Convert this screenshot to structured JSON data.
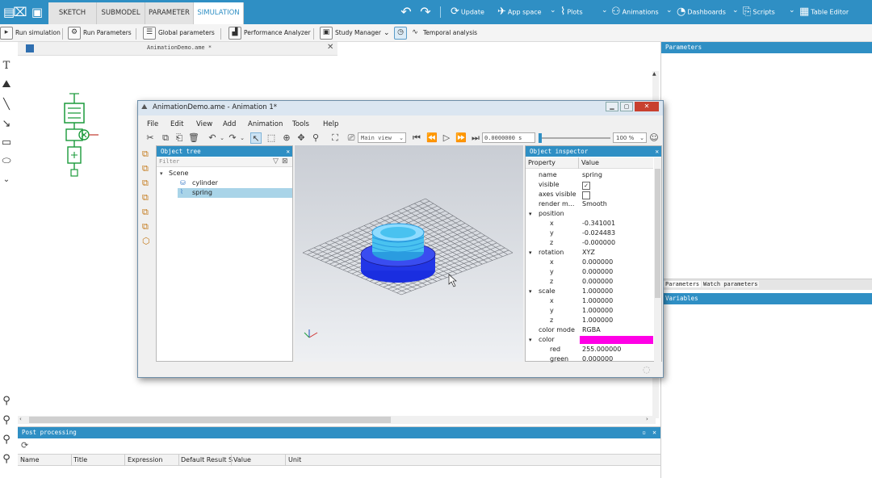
{
  "ribbon": {
    "tabs": [
      "SKETCH",
      "SUBMODEL",
      "PARAMETER",
      "SIMULATION"
    ],
    "active_tab": "SIMULATION",
    "buttons": [
      "Update",
      "App space",
      "Plots",
      "Animations",
      "Dashboards",
      "Scripts",
      "Table Editor"
    ]
  },
  "toolbar2": {
    "run_simulation": "Run simulation",
    "run_parameters": "Run Parameters",
    "global_parameters": "Global parameters",
    "performance_analyzer": "Performance Analyzer",
    "study_manager": "Study Manager",
    "temporal_analysis": "Temporal analysis"
  },
  "sketch": {
    "tab_title": "AnimationDemo.ame *"
  },
  "right_panel": {
    "parameters_title": "Parameters",
    "tabs": [
      "Parameters",
      "Watch parameters"
    ],
    "variables_title": "Variables"
  },
  "post_processing": {
    "title": "Post processing",
    "columns": [
      "Name",
      "Title",
      "Expression",
      "Default Result S",
      "Value",
      "Unit"
    ]
  },
  "anim_window": {
    "title": "AnimationDemo.ame - Animation 1*",
    "menu": [
      "File",
      "Edit",
      "View",
      "Add",
      "Animation",
      "Tools",
      "Help"
    ],
    "view_select": "Main view",
    "time_value": "0.0000000 s",
    "zoom_select": "100 %",
    "object_tree": {
      "title": "Object tree",
      "filter_placeholder": "Filter",
      "root": "Scene",
      "children": [
        "cylinder",
        "spring"
      ],
      "selected": "spring"
    },
    "object_inspector": {
      "title": "Object inspector",
      "col_property": "Property",
      "col_value": "Value",
      "rows": [
        {
          "property": "name",
          "value": "spring",
          "indent": 1
        },
        {
          "property": "visible",
          "value": "checked",
          "indent": 1,
          "type": "checkbox"
        },
        {
          "property": "axes visible",
          "value": "unchecked",
          "indent": 1,
          "type": "checkbox"
        },
        {
          "property": "render m...",
          "value": "Smooth",
          "indent": 1
        },
        {
          "property": "position",
          "value": "",
          "indent": 0,
          "group": true
        },
        {
          "property": "x",
          "value": "-0.341001",
          "indent": 2
        },
        {
          "property": "y",
          "value": "-0.024483",
          "indent": 2
        },
        {
          "property": "z",
          "value": "-0.000000",
          "indent": 2
        },
        {
          "property": "rotation",
          "value": "XYZ",
          "indent": 0,
          "group": true
        },
        {
          "property": "x",
          "value": "0.000000",
          "indent": 2
        },
        {
          "property": "y",
          "value": "0.000000",
          "indent": 2
        },
        {
          "property": "z",
          "value": "0.000000",
          "indent": 2
        },
        {
          "property": "scale",
          "value": "1.000000",
          "indent": 0,
          "group": true
        },
        {
          "property": "x",
          "value": "1.000000",
          "indent": 2
        },
        {
          "property": "y",
          "value": "1.000000",
          "indent": 2
        },
        {
          "property": "z",
          "value": "1.000000",
          "indent": 2
        },
        {
          "property": "color mode",
          "value": "RGBA",
          "indent": 1
        },
        {
          "property": "color",
          "value": "",
          "indent": 0,
          "group": true,
          "swatch": "#ff00e6"
        },
        {
          "property": "red",
          "value": "255.000000",
          "indent": 3
        },
        {
          "property": "green",
          "value": "0.000000",
          "indent": 3
        }
      ]
    }
  },
  "colors": {
    "accent": "#2f8fc4",
    "spring_color": "#ff00e6",
    "cylinder_top": "#49c2f0",
    "cylinder_base": "#1a2ee0"
  }
}
